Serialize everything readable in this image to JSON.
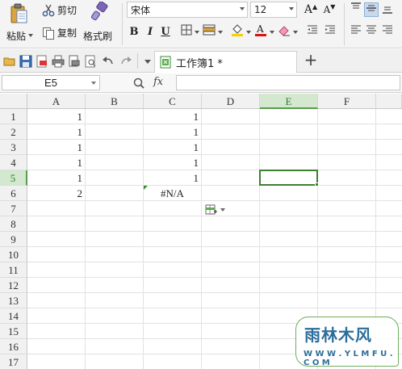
{
  "ribbon": {
    "paste_label": "粘贴",
    "cut_label": "剪切",
    "copy_label": "复制",
    "format_painter_label": "格式刷",
    "font_name": "宋体",
    "font_size": "12",
    "bold": "B",
    "italic": "I",
    "underline": "U",
    "grow_font": "A",
    "shrink_font": "A"
  },
  "tabs": {
    "document_title": "工作簿1 *",
    "new_tab": "+"
  },
  "formula_bar": {
    "name_box": "E5",
    "fx_label": "fx",
    "formula_value": ""
  },
  "sheet": {
    "columns": [
      "A",
      "B",
      "C",
      "D",
      "E",
      "F"
    ],
    "rows": [
      "1",
      "2",
      "3",
      "4",
      "5",
      "6",
      "7",
      "8",
      "9",
      "10",
      "11",
      "12",
      "13",
      "14",
      "15",
      "16",
      "17"
    ],
    "selected_column": "E",
    "selected_row": "5",
    "cells": {
      "A1": "1",
      "A2": "1",
      "A3": "1",
      "A4": "1",
      "A5": "1",
      "A6": "2",
      "C1": "1",
      "C2": "1",
      "C3": "1",
      "C4": "1",
      "C5": "1",
      "C6": "#N/A"
    }
  },
  "watermark": {
    "title": "雨林木风",
    "url": "W W W . Y L M F U . C O M"
  },
  "colors": {
    "selection_green": "#3f7f34",
    "header_selected_bg": "#d3e8cf",
    "watermark_blue": "#2b6e9b"
  }
}
